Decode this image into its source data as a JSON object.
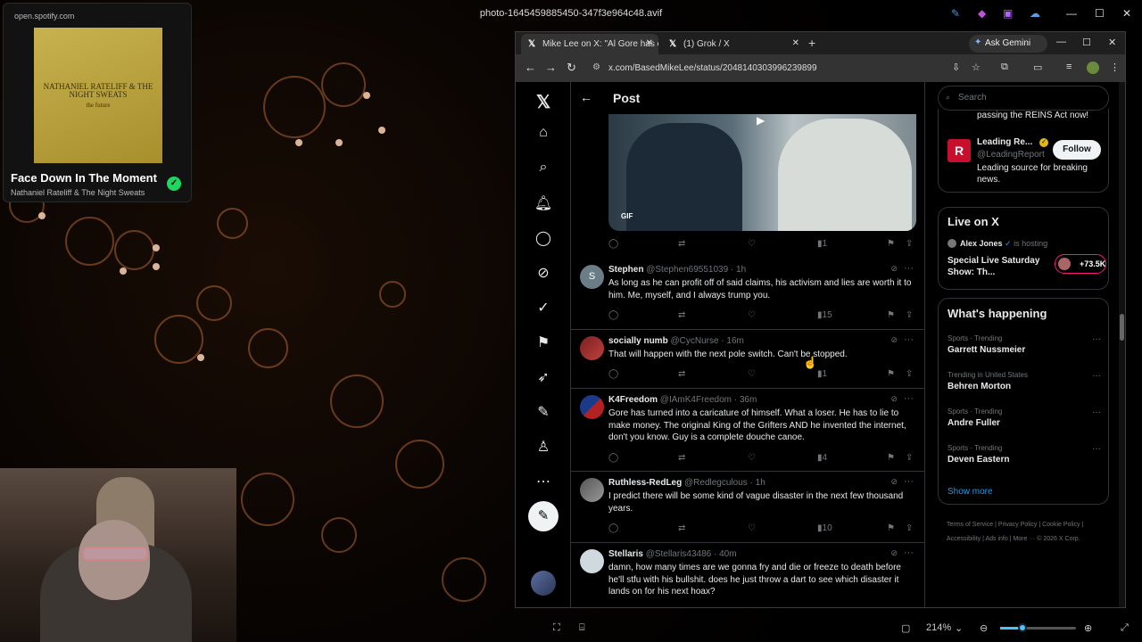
{
  "viewer": {
    "title": "photo-1645459885450-347f3e964c48.avif",
    "zoom": "214%"
  },
  "spotify": {
    "url": "open.spotify.com",
    "song": "Face Down In The Moment",
    "artist": "Nathaniel Rateliff & The Night Sweats",
    "album_text": "NATHANIEL RATELIFF & THE NIGHT SWEATS",
    "album_sub": "the future"
  },
  "browser": {
    "tabs": [
      {
        "label": "Mike Lee on X: \"Al Gore has ca"
      },
      {
        "label": "(1) Grok / X"
      }
    ],
    "gemini": "Ask Gemini",
    "url": "x.com/BasedMikeLee/status/2048140303996239899"
  },
  "post": {
    "title": "Post",
    "gif": "GIF",
    "views": "1"
  },
  "tweets": [
    {
      "name": "Stephen",
      "meta": "@Stephen69551039 · 1h",
      "text": "As long as he can profit off of said claims, his activism and lies are worth it to him. Me, myself, and I always trump you.",
      "views": "15"
    },
    {
      "name": "socially numb",
      "meta": "@CycNurse · 16m",
      "text": "That will happen with the next pole switch.  Can't be stopped.",
      "views": "1"
    },
    {
      "name": "K4Freedom",
      "meta": "@IAmK4Freedom · 36m",
      "text": "Gore has turned into a caricature of himself. What a loser. He has to lie to make money. The original King of the Grifters AND he invented the internet, don't  you know. Guy is a complete douche canoe.",
      "views": "4"
    },
    {
      "name": "Ruthless-RedLeg",
      "meta": "@Redlegculous · 1h",
      "text": "I predict there will be some kind of vague disaster in the next few thousand years.",
      "views": "10"
    },
    {
      "name": "Stellaris",
      "meta": "@Stellaris43486 · 40m",
      "text": "damn, how many times are we gonna fry and die or freeze to death before he'll stfu with his bullshit. does he just throw a dart to see which disaster it lands on for his next hoax?",
      "views": ""
    }
  ],
  "right": {
    "search": "Search",
    "who_prev": "passing the REINS Act now!",
    "follow_card": {
      "name": "Leading Re...",
      "handle": "@LeadingReport",
      "desc": "Leading source for breaking news.",
      "button": "Follow",
      "logo": "R"
    },
    "live": {
      "title": "Live on X",
      "host": "Alex Jones",
      "host_suffix": "is hosting",
      "show": "Special Live Saturday Show: Th...",
      "count": "+73.5K"
    },
    "trending": {
      "title": "What's happening",
      "items": [
        {
          "cat": "Sports · Trending",
          "name": "Garrett Nussmeier"
        },
        {
          "cat": "Trending in United States",
          "name": "Behren Morton"
        },
        {
          "cat": "Sports · Trending",
          "name": "Andre Fuller"
        },
        {
          "cat": "Sports · Trending",
          "name": "Deven Eastern"
        }
      ],
      "show_more": "Show more"
    },
    "footer": "Terms of Service  |  Privacy Policy  |  Cookie Policy  |  Accessibility  |  Ads info  |  More ···  © 2026 X Corp."
  },
  "colors": {
    "accent": "#1d9bf0",
    "pink": "#f91880",
    "gold": "#e2b719",
    "red": "#c8102e"
  }
}
